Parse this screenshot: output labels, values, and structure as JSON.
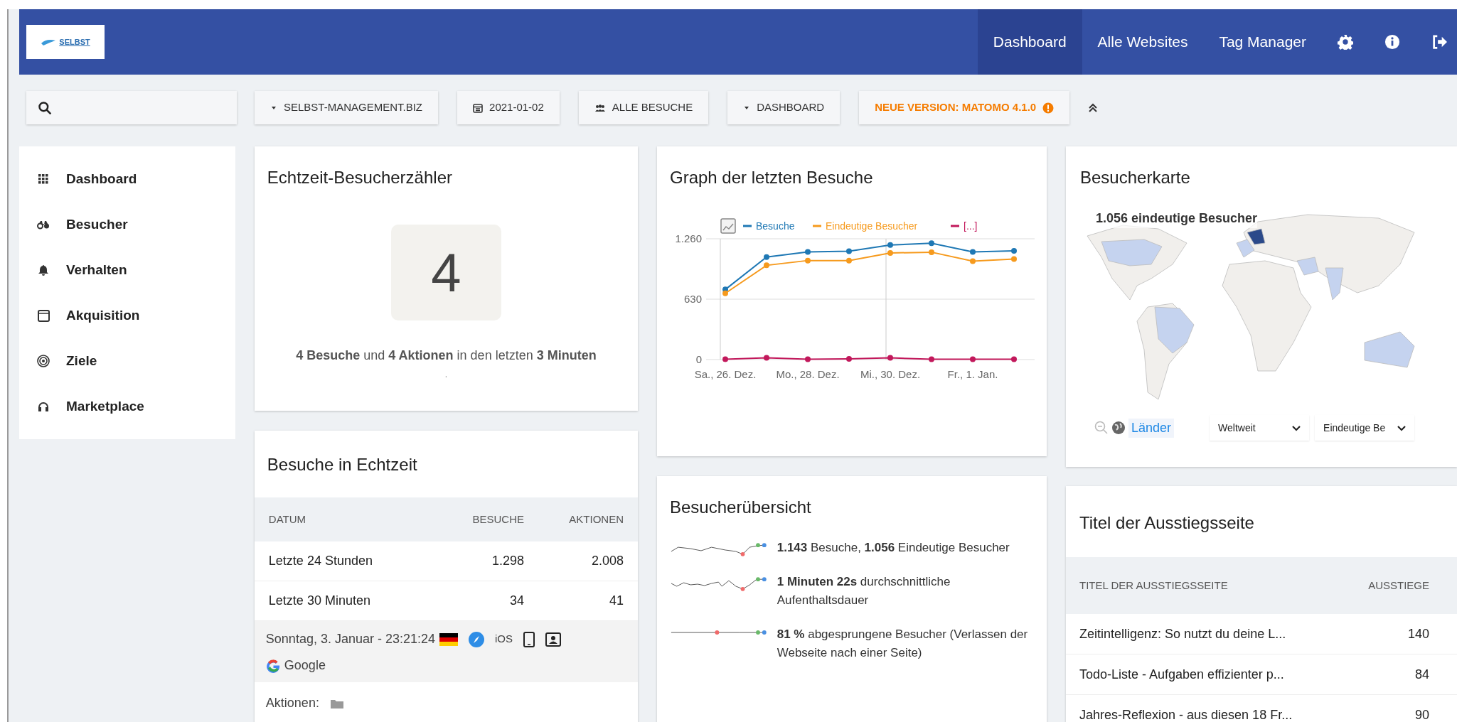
{
  "header": {
    "logo_text": "SELBST",
    "nav": [
      {
        "label": "Dashboard",
        "selected": true
      },
      {
        "label": "Alle Websites",
        "selected": false
      },
      {
        "label": "Tag Manager",
        "selected": false
      }
    ]
  },
  "toolbar": {
    "buttons": [
      {
        "kind": "dropdown",
        "label": "SELBST-MANAGEMENT.BIZ"
      },
      {
        "kind": "calendar",
        "label": "2021-01-02"
      },
      {
        "kind": "segment",
        "label": "ALLE BESUCHE"
      },
      {
        "kind": "dropdown",
        "label": "DASHBOARD"
      },
      {
        "kind": "notice",
        "label": "NEUE VERSION: MATOMO 4.1.0"
      }
    ]
  },
  "sidebar": {
    "items": [
      {
        "kind": "grid",
        "label": "Dashboard"
      },
      {
        "kind": "binoculars",
        "label": "Besucher"
      },
      {
        "kind": "bell",
        "label": "Verhalten"
      },
      {
        "kind": "window",
        "label": "Akquisition"
      },
      {
        "kind": "target",
        "label": "Ziele"
      },
      {
        "kind": "headphones",
        "label": "Marketplace"
      }
    ]
  },
  "realtime_counter": {
    "title": "Echtzeit-Besucherzähler",
    "count": "4",
    "summary": "**4 Besuche** und **4 Aktionen** in den letzten **3 Minuten**",
    "footer": "."
  },
  "realtime_visits": {
    "title": "Besuche in Echtzeit",
    "columns": [
      "DATUM",
      "BESUCHE",
      "AKTIONEN"
    ],
    "rows": [
      [
        "Letzte 24 Stunden",
        "1.298",
        "2.008"
      ],
      [
        "Letzte 30 Minuten",
        "34",
        "41"
      ]
    ],
    "visit": {
      "datetime": "Sonntag, 3. Januar - 23:21:24",
      "os": "iOS",
      "referrer": "Google",
      "actions_label": "Aktionen:"
    }
  },
  "visits_graph": {
    "title": "Graph der letzten Besuche",
    "chart_data": {
      "type": "line",
      "legend": "top",
      "categories": [
        "Sa., 26. Dez.",
        null,
        "Mo., 28. Dez.",
        null,
        "Mi., 30. Dez.",
        null,
        "Fr., 1. Jan.",
        null
      ],
      "yticks": [
        {
          "value": 0,
          "label": "0"
        },
        {
          "value": 630,
          "label": "630"
        },
        {
          "value": 1260,
          "label": "1.260"
        }
      ],
      "ylim": [
        0,
        1260
      ],
      "series": [
        {
          "name": "Besuche",
          "color": "#1f78b4",
          "marker": "circle",
          "values": [
            731,
            1069,
            1123,
            1130,
            1195,
            1213,
            1123,
            1134
          ]
        },
        {
          "name": "Eindeutige Besucher",
          "color": "#f69a1d",
          "marker": "circle",
          "values": [
            691,
            983,
            1033,
            1033,
            1112,
            1120,
            1026,
            1048
          ]
        },
        {
          "name": "[...]",
          "color": "#c2185b",
          "marker": "circle",
          "values": [
            4,
            18,
            3,
            8,
            18,
            3,
            3,
            3
          ]
        }
      ]
    }
  },
  "visitor_overview": {
    "title": "Besucherübersicht",
    "metrics": [
      "**1.143** Besuche, **1.056** Eindeutige Besucher",
      "**1 Minuten 22s** durchschnittliche Aufenthaltsdauer",
      "**81 %** abgesprungene Besucher (Verlassen der Webseite nach einer Seite)"
    ]
  },
  "visitor_map": {
    "title": "Besucherkarte",
    "caption": "1.056 eindeutige Besucher",
    "link": "Länder",
    "selects": [
      "Weltweit",
      "Eindeutige Be"
    ]
  },
  "exit_pages": {
    "title": "Titel der Ausstiegsseite",
    "columns": [
      "TITEL DER AUSSTIEGSSEITE",
      "AUSSTIEGE"
    ],
    "rows": [
      [
        "Zeitintelligenz: So nutzt du deine L...",
        "140"
      ],
      [
        "Todo-Liste - Aufgaben effizienter p...",
        "84"
      ],
      [
        "Jahres-Reflexion - aus diesen 18 Fr...",
        "90"
      ]
    ]
  }
}
